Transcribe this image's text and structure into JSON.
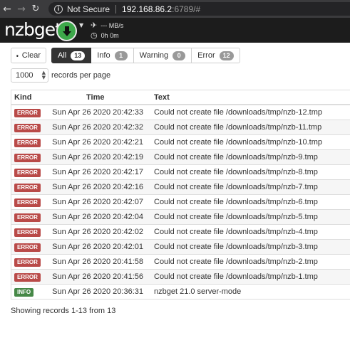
{
  "browser": {
    "security_label": "Not Secure",
    "host": "192.168.86.2",
    "path": ":6789/#"
  },
  "navbar": {
    "logo_prefix": "nzb",
    "logo_suffix": "get",
    "speed": "--- MB/s",
    "remaining_time": "0h 0m"
  },
  "toolbar": {
    "clear_label": "Clear",
    "tabs": [
      {
        "label": "All",
        "count": "13",
        "active": true
      },
      {
        "label": "Info",
        "count": "1",
        "active": false
      },
      {
        "label": "Warning",
        "count": "0",
        "active": false
      },
      {
        "label": "Error",
        "count": "12",
        "active": false
      }
    ],
    "records_value": "1000",
    "records_label": "records per page"
  },
  "table": {
    "headers": {
      "kind": "Kind",
      "time": "Time",
      "text": "Text"
    },
    "rows": [
      {
        "kind": "ERROR",
        "time": "Sun Apr 26 2020 20:42:33",
        "text": "Could not create file /downloads/tmp/nzb-12.tmp"
      },
      {
        "kind": "ERROR",
        "time": "Sun Apr 26 2020 20:42:32",
        "text": "Could not create file /downloads/tmp/nzb-11.tmp"
      },
      {
        "kind": "ERROR",
        "time": "Sun Apr 26 2020 20:42:21",
        "text": "Could not create file /downloads/tmp/nzb-10.tmp"
      },
      {
        "kind": "ERROR",
        "time": "Sun Apr 26 2020 20:42:19",
        "text": "Could not create file /downloads/tmp/nzb-9.tmp"
      },
      {
        "kind": "ERROR",
        "time": "Sun Apr 26 2020 20:42:17",
        "text": "Could not create file /downloads/tmp/nzb-8.tmp"
      },
      {
        "kind": "ERROR",
        "time": "Sun Apr 26 2020 20:42:16",
        "text": "Could not create file /downloads/tmp/nzb-7.tmp"
      },
      {
        "kind": "ERROR",
        "time": "Sun Apr 26 2020 20:42:07",
        "text": "Could not create file /downloads/tmp/nzb-6.tmp"
      },
      {
        "kind": "ERROR",
        "time": "Sun Apr 26 2020 20:42:04",
        "text": "Could not create file /downloads/tmp/nzb-5.tmp"
      },
      {
        "kind": "ERROR",
        "time": "Sun Apr 26 2020 20:42:02",
        "text": "Could not create file /downloads/tmp/nzb-4.tmp"
      },
      {
        "kind": "ERROR",
        "time": "Sun Apr 26 2020 20:42:01",
        "text": "Could not create file /downloads/tmp/nzb-3.tmp"
      },
      {
        "kind": "ERROR",
        "time": "Sun Apr 26 2020 20:41:58",
        "text": "Could not create file /downloads/tmp/nzb-2.tmp"
      },
      {
        "kind": "ERROR",
        "time": "Sun Apr 26 2020 20:41:56",
        "text": "Could not create file /downloads/tmp/nzb-1.tmp"
      },
      {
        "kind": "INFO",
        "time": "Sun Apr 26 2020 20:36:31",
        "text": "nzbget 21.0 server-mode"
      }
    ]
  },
  "footer": {
    "summary": "Showing records 1-13 from 13"
  },
  "colors": {
    "error": "#b94a48",
    "info": "#468847",
    "download_button": "#3da84a"
  }
}
